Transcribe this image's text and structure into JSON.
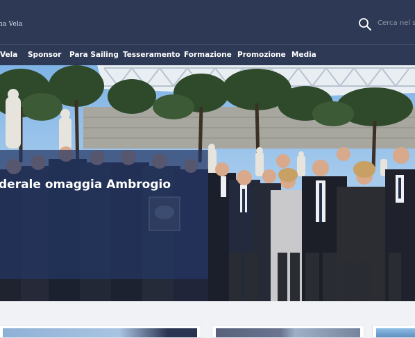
{
  "header": {
    "logo_text": "na Vela",
    "search": {
      "placeholder": "Cerca nel sito",
      "icon": "search-icon"
    }
  },
  "nav": {
    "items": [
      {
        "label": "Vela"
      },
      {
        "label": "Sponsor"
      },
      {
        "label": "Para Sailing"
      },
      {
        "label": "Tesseramento"
      },
      {
        "label": "Formazione"
      },
      {
        "label": "Promozione"
      },
      {
        "label": "Media"
      }
    ]
  },
  "hero": {
    "caption": "derale omaggia Ambrogio"
  },
  "colors": {
    "header_bg": "#2e3a55",
    "caption_overlay": "#243664",
    "page_bg": "#f0f2f5"
  }
}
